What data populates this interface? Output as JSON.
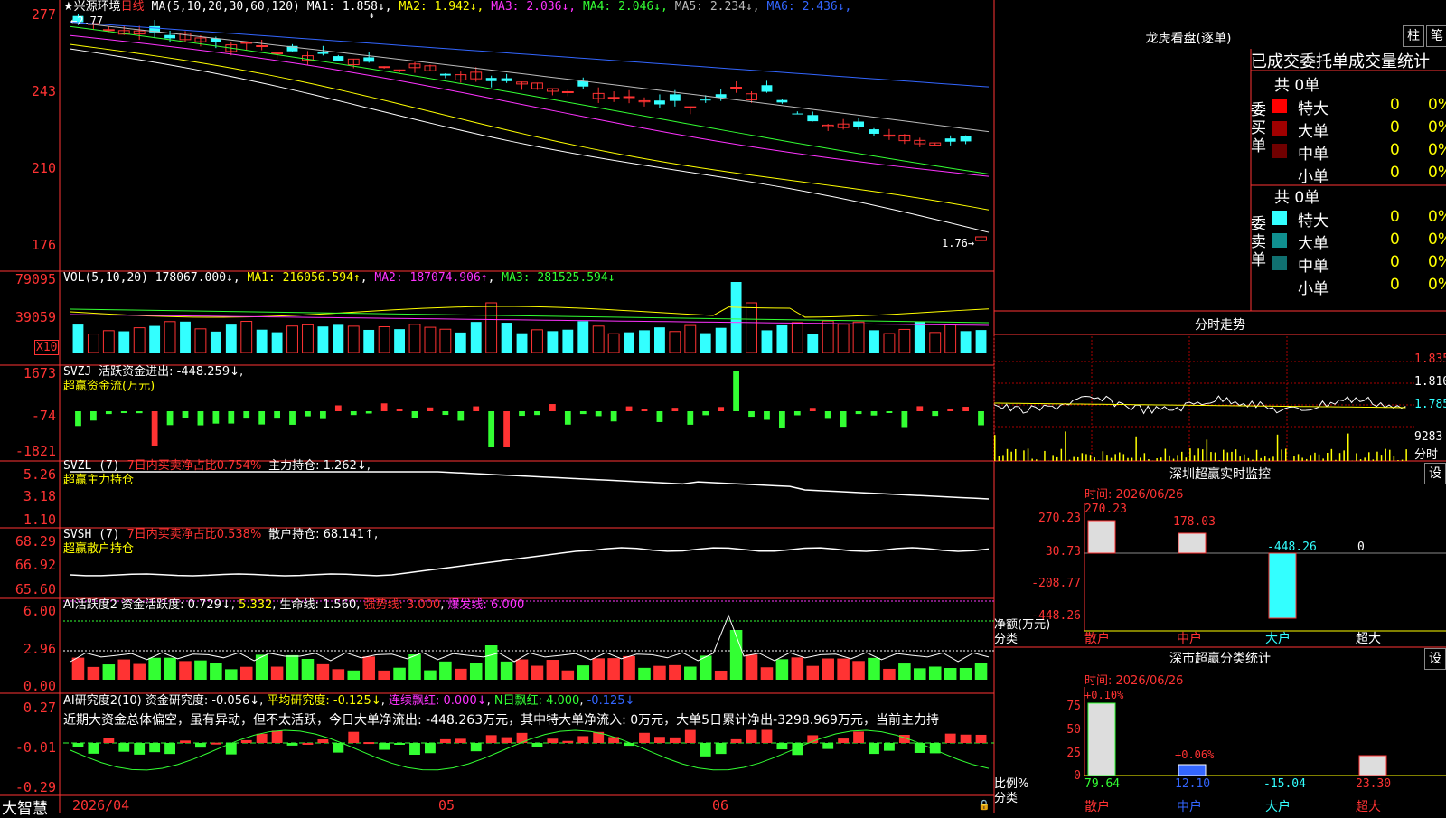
{
  "main": {
    "name": "★兴源环境",
    "period": "日线",
    "ma_formula": "MA(5,10,20,30,60,120)",
    "ma": [
      {
        "label": "MA1: 1.858↓",
        "color": "#ffffff"
      },
      {
        "label": "MA2: 1.942↓",
        "color": "#ffff00"
      },
      {
        "label": "MA3: 2.036↓",
        "color": "#ff33ff"
      },
      {
        "label": "MA4: 2.046↓",
        "color": "#33ff33"
      },
      {
        "label": "MA5: 2.234↓",
        "color": "#bbbbbb"
      },
      {
        "label": "MA6: 2.436↓",
        "color": "#3366ff"
      }
    ],
    "y_ticks": [
      "277",
      "243",
      "210",
      "176"
    ],
    "high_label": "2.77",
    "low_label": "1.76→"
  },
  "vol": {
    "header": "VOL(5,10,20)",
    "value": "178067.000↓",
    "ma1": "MA1: 216056.594↑",
    "ma2": "MA2: 187074.906↑",
    "ma3": "MA3: 281525.594↓",
    "y_ticks": [
      "79095",
      "39059"
    ],
    "unit": "X10"
  },
  "svzj": {
    "header": "SVZJ",
    "text": "活跃资金进出: -448.259↓,",
    "sub": "超赢资金流(万元)",
    "y_ticks": [
      "1673",
      "-74",
      "-1821"
    ]
  },
  "svzl": {
    "header": "SVZL (7)",
    "text1": "7日内买卖净占比0.754%",
    "text2": "主力持仓: 1.262↓,",
    "sub": "超赢主力持仓",
    "y_ticks": [
      "5.26",
      "3.18",
      "1.10"
    ]
  },
  "svsh": {
    "header": "SVSH (7)",
    "text1": "7日内买卖净占比0.538%",
    "text2": "散户持仓: 68.141↑,",
    "sub": "超赢散户持仓",
    "y_ticks": [
      "68.29",
      "66.92",
      "65.60"
    ]
  },
  "ai1": {
    "header": "AI活跃度2",
    "t1": "资金活跃度: 0.729↓",
    "t2": "5.332",
    "t3": "生命线: 1.560",
    "t4": "强势线: 3.000",
    "t5": "爆发线: 6.000",
    "y_ticks": [
      "6.00",
      "2.96",
      "0.00"
    ]
  },
  "ai2": {
    "header": "AI研究度2(10)",
    "t1": "资金研究度: -0.056↓",
    "t2": "平均研究度: -0.125↓",
    "t3": "连续飘红: 0.000↓",
    "t4": "N日飘红: 4.000",
    "t5": "-0.125↓",
    "commentary": "近期大资金总体偏空，虽有异动，但不太活跃，今日大单净流出: -448.263万元，其中特大单净流入: 0万元，大单5日累计净出-3298.969万元，当前主力持",
    "y_ticks": [
      "0.27",
      "-0.01",
      "-0.29"
    ]
  },
  "bottom": {
    "brand": "大智慧",
    "dates": [
      "2026/04",
      "05",
      "06"
    ]
  },
  "right": {
    "lhb_title": "龙虎看盘(逐单)",
    "btn_zhu": "柱",
    "btn_bi": "笔",
    "tabs": "已成交委托单成交量统计",
    "buy_label": "委买单",
    "sell_label": "委卖单",
    "buy_total": "共 0单",
    "sell_total": "共 0单",
    "buy_rows": [
      {
        "name": "特大",
        "count": "0",
        "pct": "0%",
        "color": "#ff0000"
      },
      {
        "name": "大单",
        "count": "0",
        "pct": "0%",
        "color": "#a00000"
      },
      {
        "name": "中单",
        "count": "0",
        "pct": "0%",
        "color": "#700000"
      },
      {
        "name": "小单",
        "count": "0",
        "pct": "0%",
        "color": "#000000"
      }
    ],
    "sell_rows": [
      {
        "name": "特大",
        "count": "0",
        "pct": "0%",
        "color": "#33ffff"
      },
      {
        "name": "大单",
        "count": "0",
        "pct": "0%",
        "color": "#109090"
      },
      {
        "name": "中单",
        "count": "0",
        "pct": "0%",
        "color": "#107070"
      },
      {
        "name": "小单",
        "count": "0",
        "pct": "0%",
        "color": "#000000"
      }
    ],
    "fenshi_title": "分时走势",
    "fenshi_prices": [
      "1.835",
      "1.810",
      "1.785"
    ],
    "fenshi_vol": "9283",
    "fenshi_label": "分时",
    "sz_title": "深圳超赢实时监控",
    "sz_btn": "设",
    "sz_time": "时间: 2026/06/26",
    "sz_y": [
      "270.23",
      "30.73",
      "-208.77",
      "-448.26"
    ],
    "sz_vals": [
      "270.23",
      "178.03",
      "-448.26",
      "0"
    ],
    "sz_cats": [
      "散户",
      "中户",
      "大户",
      "超大"
    ],
    "sz_ylabel": "净额(万元)",
    "sz_xlabel": "分类",
    "cls_title": "深市超赢分类统计",
    "cls_btn": "设",
    "cls_time": "时间: 2026/06/26",
    "cls_y": [
      "75",
      "50",
      "25",
      "0"
    ],
    "cls_top": [
      "+0.10%",
      "+0.06%"
    ],
    "cls_vals": [
      "79.64",
      "12.10",
      "-15.04",
      "23.30"
    ],
    "cls_cats": [
      "散户",
      "中户",
      "大户",
      "超大"
    ],
    "cls_ylabel": "比例%",
    "cls_xlabel": "分类"
  }
}
